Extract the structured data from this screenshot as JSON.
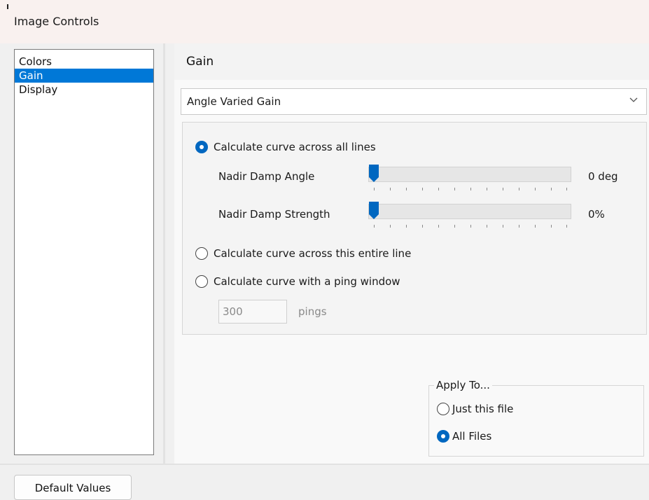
{
  "window": {
    "title": "Image Controls"
  },
  "nav": {
    "items": [
      "Colors",
      "Gain",
      "Display"
    ],
    "selected": "Gain"
  },
  "panel": {
    "title": "Gain",
    "gain_type": {
      "value": "Angle Varied Gain",
      "icon": "chevron-down-icon"
    },
    "options": {
      "all_lines": {
        "label": "Calculate curve across all lines",
        "checked": true
      },
      "entire_line": {
        "label": "Calculate curve across this entire line",
        "checked": false
      },
      "ping_window": {
        "label": "Calculate curve with a ping window",
        "checked": false
      }
    },
    "nadir_angle": {
      "label": "Nadir Damp Angle",
      "value": "0 deg",
      "position": 0
    },
    "nadir_strength": {
      "label": "Nadir Damp Strength",
      "value": "0%",
      "position": 0
    },
    "ping_window": {
      "value": "300",
      "unit": "pings"
    }
  },
  "apply_to": {
    "legend": "Apply To...",
    "just_this_file": {
      "label": "Just this file",
      "checked": false
    },
    "all_files": {
      "label": "All Files",
      "checked": true
    }
  },
  "footer": {
    "default_button": "Default Values"
  },
  "colors": {
    "accent": "#0067c0",
    "selection": "#0078d7"
  }
}
